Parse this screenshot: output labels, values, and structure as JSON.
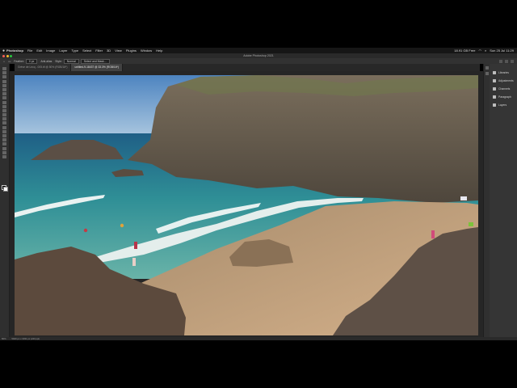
{
  "menubar": {
    "app": "Photoshop",
    "items": [
      "File",
      "Edit",
      "Image",
      "Layer",
      "Type",
      "Select",
      "Filter",
      "3D",
      "View",
      "Plugins",
      "Window",
      "Help"
    ],
    "right_status": "18.91 GB Free",
    "clock": "Sun 25 Jul  11:29"
  },
  "titlebar": {
    "title": "Adobe Photoshop 2021"
  },
  "options": {
    "feather_label": "Feather:",
    "feather_value": "0 px",
    "anti_alias_label": "Anti-alias",
    "style_label": "Style:",
    "style_value": "Normal",
    "select_mask_label": "Select and Mask..."
  },
  "tabs": [
    {
      "label": "Grève de Lecq - 005.tif @ 50% (RGB/16*)"
    },
    {
      "label": "untitled-9-18437 @ 33.3% (RGB/16*)"
    }
  ],
  "panel": {
    "items": [
      {
        "label": "Libraries",
        "icon": "libraries-icon"
      },
      {
        "label": "Adjustments",
        "icon": "adjustments-icon"
      },
      {
        "label": "Channels",
        "icon": "channels-icon"
      },
      {
        "label": "Paragraph",
        "icon": "paragraph-icon"
      },
      {
        "label": "Layers",
        "icon": "layers-icon"
      }
    ]
  },
  "status": {
    "zoom": "50%",
    "doc_info": "5920 px x 3331 px (240 ppi)"
  },
  "colors": {
    "sky": "#5a8fc6",
    "sea": "#2e8a90",
    "sand": "#c4a27a",
    "rock": "#5e5548"
  }
}
